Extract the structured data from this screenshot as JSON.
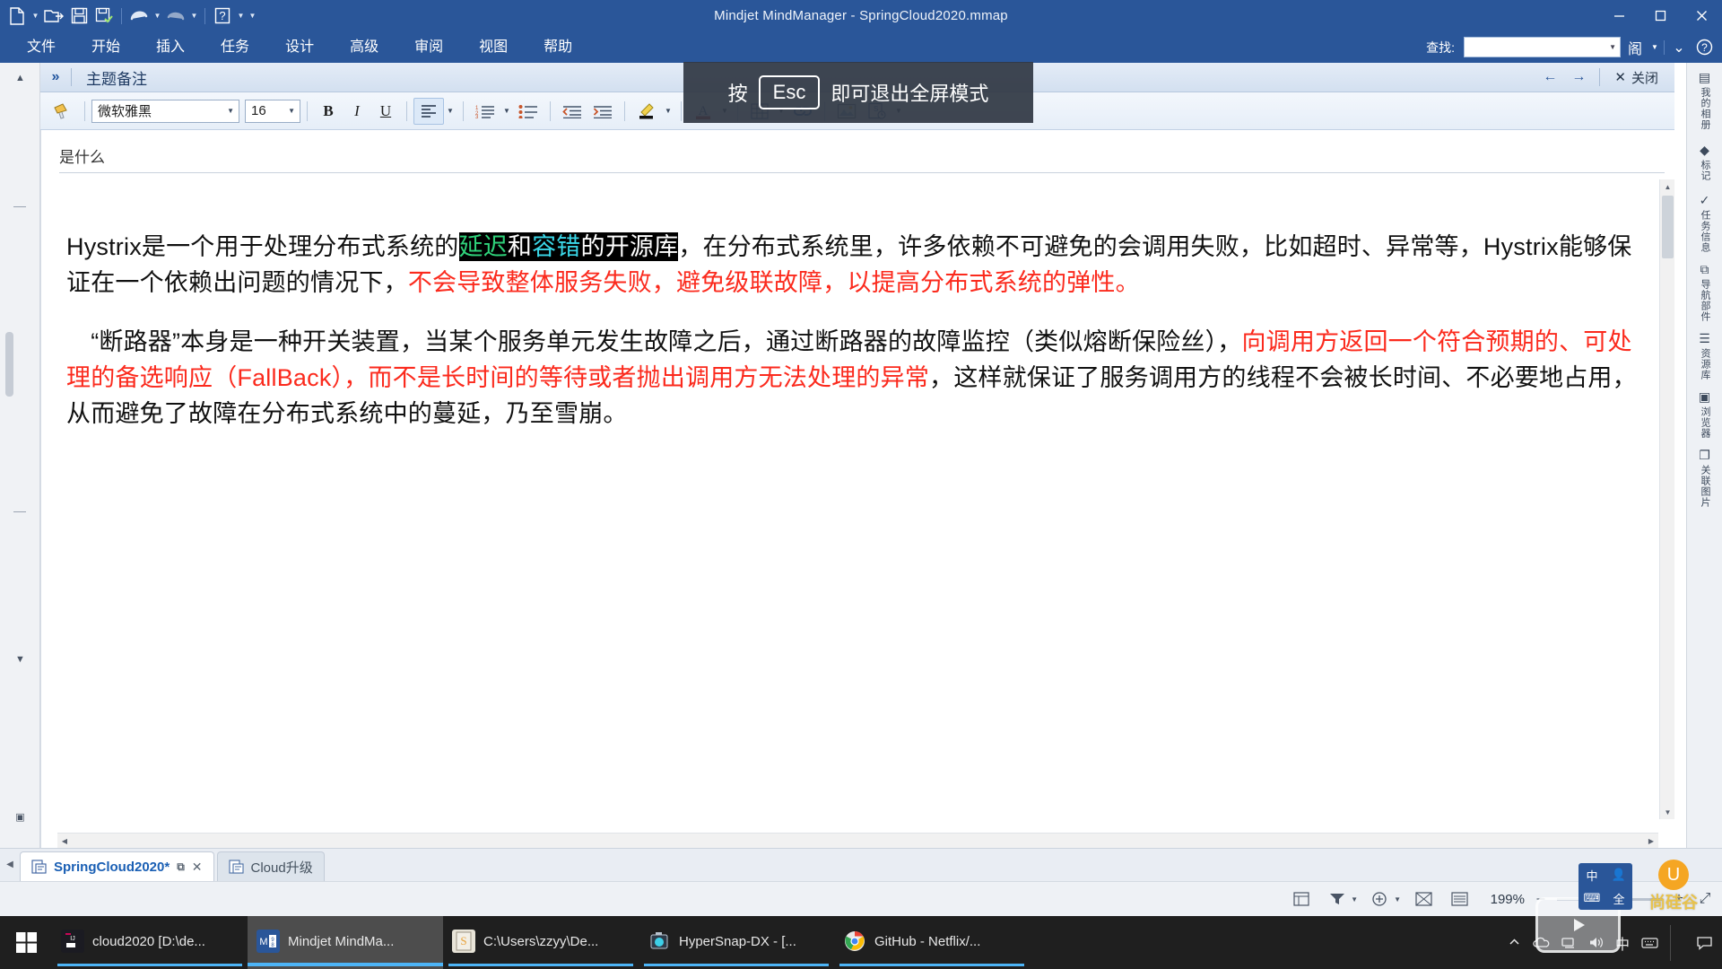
{
  "window": {
    "title": "Mindjet MindManager - SpringCloud2020.mmap",
    "minimize_label": "–",
    "maximize_label": "❐",
    "close_label": "✕"
  },
  "quick_access": {
    "items": [
      {
        "name": "new-document-icon",
        "glyph": "🗋",
        "has_caret": true
      },
      {
        "name": "open-folder-icon",
        "glyph": "📂",
        "has_caret": false
      },
      {
        "name": "save-icon",
        "glyph": "💾",
        "has_caret": false
      },
      {
        "name": "save-all-icon",
        "glyph": "🖫",
        "has_caret": false
      },
      {
        "name": "undo-icon",
        "glyph": "↶",
        "has_caret": true
      },
      {
        "name": "redo-icon",
        "glyph": "↷",
        "has_caret": true
      },
      {
        "name": "help-icon",
        "glyph": "?",
        "has_caret": true
      },
      {
        "name": "customize-qat-icon",
        "glyph": "▾",
        "has_caret": false
      }
    ]
  },
  "menu": {
    "items": [
      {
        "label": "文件",
        "key": "file"
      },
      {
        "label": "开始",
        "key": "home"
      },
      {
        "label": "插入",
        "key": "insert"
      },
      {
        "label": "任务",
        "key": "task"
      },
      {
        "label": "设计",
        "key": "design"
      },
      {
        "label": "高级",
        "key": "advanced"
      },
      {
        "label": "审阅",
        "key": "review"
      },
      {
        "label": "视图",
        "key": "view"
      },
      {
        "label": "帮助",
        "key": "help"
      }
    ],
    "find_label": "查找:",
    "find_value": "",
    "find_placeholder": "",
    "right_icons": [
      {
        "name": "find-options-icon",
        "glyph": "阁"
      },
      {
        "name": "ribbon-display-chevron-icon",
        "glyph": "⌄"
      },
      {
        "name": "help-circle-icon",
        "glyph": "?"
      }
    ]
  },
  "notes_panel": {
    "expand_chevron": "»",
    "title": "主题备注",
    "nav_back": "←",
    "nav_forward": "→",
    "close_glyph": "✕",
    "close_label": "关闭"
  },
  "format_toolbar": {
    "format_painter": {
      "name": "format-painter-icon",
      "glyph": "🖌"
    },
    "font_family": "微软雅黑",
    "font_size": "16",
    "bold": "B",
    "italic": "I",
    "underline": "U",
    "align": {
      "name": "align-left-icon",
      "glyph": "≡"
    },
    "numbered_list": {
      "name": "numbered-list-icon",
      "glyph": "≣"
    },
    "bulleted_list": {
      "name": "bulleted-list-icon",
      "glyph": "≣"
    },
    "decrease_indent": {
      "name": "decrease-indent-icon",
      "glyph": "⇤"
    },
    "increase_indent": {
      "name": "increase-indent-icon",
      "glyph": "⇥"
    },
    "highlight": {
      "name": "highlight-color-icon",
      "glyph": "✎"
    },
    "font_color": {
      "name": "font-color-icon",
      "glyph": "A"
    },
    "insert_table": {
      "name": "insert-table-icon",
      "glyph": "▦"
    },
    "hyperlink": {
      "name": "hyperlink-icon",
      "glyph": "🔗"
    },
    "insert_image": {
      "name": "insert-image-icon",
      "glyph": "🖼"
    },
    "insert_object": {
      "name": "insert-object-icon",
      "glyph": "🗒"
    }
  },
  "overlay": {
    "prefix": "按",
    "key": "Esc",
    "suffix": "即可退出全屏模式"
  },
  "editor": {
    "topic_title": "是什么",
    "paragraph1": {
      "seg1": "Hystrix是一个用于处理分布式系统的",
      "sel_green": "延迟",
      "sel_white1": "和",
      "sel_cyan": "容错",
      "sel_white2": "的开源库",
      "seg2": "，在分布式系统里，许多依赖不可避免的会调用失败，比如超时、异常等，Hystrix能够保证在一个依赖出问题的情况下，",
      "seg3_red": "不会导致整体服务失败，避免级联故障，以提高分布式系统的弹性。"
    },
    "paragraph2": {
      "seg1": "　“断路器”本身是一种开关装置，当某个服务单元发生故障之后，通过断路器的故障监控（类似熔断保险丝），",
      "seg2_red": "向调用方返回一个符合预期的、可处理的备选响应（FallBack），而不是长时间的等待或者抛出调用方无法处理的异常",
      "seg3": "，这样就保证了服务调用方的线程不会被长时间、不必要地占用，从而避免了故障在分布式系统中的蔓延，乃至雪崩。"
    }
  },
  "right_rail": {
    "items": [
      {
        "label": "我的相册",
        "icon": "album-icon",
        "glyph": "▦"
      },
      {
        "label": "标记",
        "icon": "marker-icon",
        "glyph": "◆"
      },
      {
        "label": "任务信息",
        "icon": "task-info-icon",
        "glyph": "✓"
      },
      {
        "label": "导航部件",
        "icon": "navigation-icon",
        "glyph": "⧉"
      },
      {
        "label": "资源库",
        "icon": "library-icon",
        "glyph": "☰"
      },
      {
        "label": "浏览器",
        "icon": "browser-icon",
        "glyph": "▣"
      },
      {
        "label": "关联图片",
        "icon": "linked-image-icon",
        "glyph": "❐"
      }
    ]
  },
  "tabs": {
    "nav_prev": "◀",
    "items": [
      {
        "label": "SpringCloud2020*",
        "active": true,
        "pop_out": "⧉",
        "close": "✕"
      },
      {
        "label": "Cloud升级",
        "active": false,
        "pop_out": "",
        "close": ""
      }
    ]
  },
  "status_bar": {
    "buttons": [
      {
        "name": "map-view-icon",
        "glyph": "⌸"
      },
      {
        "name": "filter-icon",
        "glyph": "▼",
        "caret": true
      },
      {
        "name": "add-view-icon",
        "glyph": "⊕",
        "caret": true
      },
      {
        "name": "outline-view-icon",
        "glyph": "☒"
      },
      {
        "name": "presentation-view-icon",
        "glyph": "▤"
      }
    ],
    "zoom_level": "199%",
    "zoom_out": "–",
    "zoom_in": "+",
    "fit_page": "⤢"
  },
  "ime": {
    "line1_left": "中",
    "line1_right": "ₐ",
    "line2_left": "⌨",
    "line2_right": "全",
    "person_glyph": "👤",
    "music_glyph": "♪"
  },
  "branding": {
    "logo_glyph": "U",
    "text": "尚硅谷"
  },
  "taskbar": {
    "start_glyph": "⊞",
    "items": [
      {
        "label": "cloud2020 [D:\\de...",
        "icon_glyph": "IJ",
        "icon_color": "#1b1b22",
        "active": false
      },
      {
        "label": "Mindjet MindMa...",
        "icon_glyph": "M",
        "icon_color": "#2a5699",
        "active": true
      },
      {
        "label": "C:\\Users\\zzyy\\De...",
        "icon_glyph": "S",
        "icon_color": "#e8e4d8",
        "active": false
      },
      {
        "label": "HyperSnap-DX - [...",
        "icon_glyph": "📷",
        "icon_color": "#2f3b49",
        "active": false
      },
      {
        "label": "GitHub - Netflix/...",
        "icon_glyph": "◉",
        "icon_color": "#e8e8e8",
        "active": false
      }
    ],
    "tray": [
      {
        "name": "show-hidden-icons",
        "glyph": "⌃"
      },
      {
        "name": "onedrive-icon",
        "glyph": "☁"
      },
      {
        "name": "network-icon",
        "glyph": "🖧"
      },
      {
        "name": "volume-icon",
        "glyph": "🔊"
      },
      {
        "name": "ime-indicator",
        "glyph": "中"
      },
      {
        "name": "ime-mode-icon",
        "glyph": "⌨"
      },
      {
        "name": "notification-center-icon",
        "glyph": "🖪"
      }
    ]
  },
  "colors": {
    "titlebar": "#2a5699",
    "accent_red": "#fb2a1d",
    "selection_bg": "#000000",
    "selection_green": "#2fd27a",
    "selection_cyan": "#3ad7e8",
    "taskbar": "#1f1f1f",
    "taskbar_underline": "#4cb4f7"
  }
}
